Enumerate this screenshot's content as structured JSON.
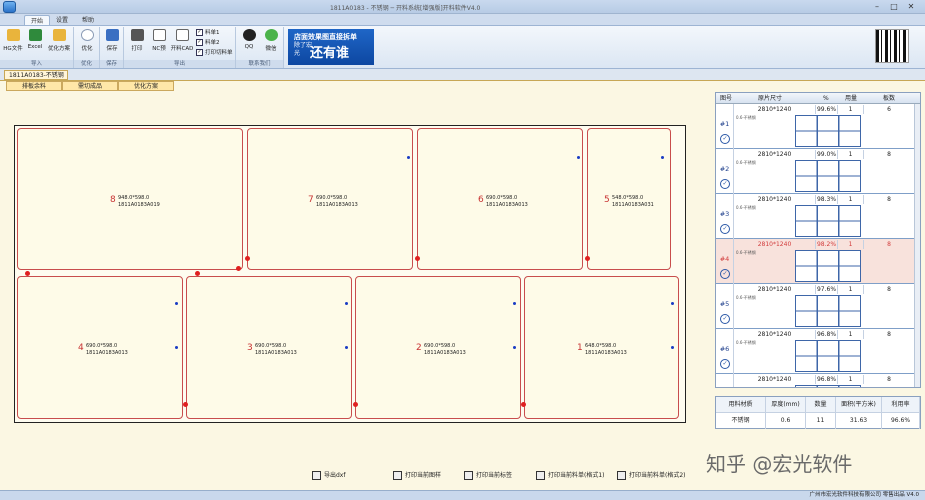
{
  "window": {
    "title": "1811A0183 - 不锈钢 ─ 开料系统[增强版]开料软件V4.0"
  },
  "ribbon": {
    "tabs": [
      "开始",
      "设置",
      "帮助"
    ],
    "import_group": {
      "label": "导入",
      "buttons": [
        "HG文件",
        "Excel",
        "优化方案"
      ]
    },
    "optimize_group": {
      "label": "优化",
      "buttons": [
        "优化"
      ]
    },
    "save_group": {
      "label": "保存",
      "buttons": [
        "保存"
      ]
    },
    "export_group": {
      "label": "导出",
      "buttons": [
        "打印",
        "NC预",
        "开料CAD"
      ],
      "checks": [
        "料单1",
        "料单2",
        "打印切料单"
      ]
    },
    "contact_group": {
      "label": "联系我们",
      "buttons": [
        "QQ",
        "微信"
      ]
    },
    "banner": {
      "line1": "店面效果图直接拆单",
      "line2": "除了宏光",
      "line3": "还有谁"
    }
  },
  "document": {
    "tab_label": "1811A0183-不锈钢",
    "subtabs": [
      "排板余料",
      "需切成品",
      "优化方案"
    ]
  },
  "plates": [
    {
      "num": "8",
      "size": "948.0*598.0",
      "code": "1811A0183A019"
    },
    {
      "num": "7",
      "size": "690.0*598.0",
      "code": "1811A0183A013"
    },
    {
      "num": "6",
      "size": "690.0*598.0",
      "code": "1811A0183A013"
    },
    {
      "num": "5",
      "size": "548.0*598.0",
      "code": "1811A0183A031"
    },
    {
      "num": "4",
      "size": "690.0*598.0",
      "code": "1811A0183A013"
    },
    {
      "num": "3",
      "size": "690.0*598.0",
      "code": "1811A0183A013"
    },
    {
      "num": "2",
      "size": "690.0*598.0",
      "code": "1811A0183A013"
    },
    {
      "num": "1",
      "size": "648.0*598.0",
      "code": "1811A0183A013"
    }
  ],
  "bottom_actions": [
    "导出dxf",
    "打印当前图样",
    "打印当前标签",
    "打印当前料单(格式1)",
    "打印当前料单(格式2)"
  ],
  "plan_table": {
    "headers": [
      "图号",
      "原片尺寸",
      "%",
      "用量",
      "板数"
    ],
    "rows": [
      {
        "id": "#1",
        "size": "2810*1240",
        "pct": "99.6%",
        "qty": "1",
        "boards": "6",
        "sub": "0.6-不锈钢"
      },
      {
        "id": "#2",
        "size": "2810*1240",
        "pct": "99.0%",
        "qty": "1",
        "boards": "8",
        "sub": "0.6-不锈钢"
      },
      {
        "id": "#3",
        "size": "2810*1240",
        "pct": "98.3%",
        "qty": "1",
        "boards": "8",
        "sub": "0.6-不锈钢"
      },
      {
        "id": "#4",
        "size": "2810*1240",
        "pct": "98.2%",
        "qty": "1",
        "boards": "8",
        "sub": "0.6-不锈钢"
      },
      {
        "id": "#5",
        "size": "2810*1240",
        "pct": "97.6%",
        "qty": "1",
        "boards": "8",
        "sub": "0.6-不锈钢"
      },
      {
        "id": "#6",
        "size": "2810*1240",
        "pct": "96.8%",
        "qty": "1",
        "boards": "8",
        "sub": "0.6-不锈钢"
      },
      {
        "id": "",
        "size": "2810*1240",
        "pct": "96.8%",
        "qty": "1",
        "boards": "8",
        "sub": ""
      }
    ]
  },
  "stats": {
    "headers": [
      "用料材质",
      "厚度(mm)",
      "数量",
      "面积(平方米)",
      "利用率"
    ],
    "values": [
      "不锈钢",
      "0.6",
      "11",
      "31.63",
      "96.6%"
    ]
  },
  "statusbar": {
    "text": "广州市宏光软件科技有限公司 零售出品 V4.0"
  },
  "watermark": "知乎 @宏光软件"
}
